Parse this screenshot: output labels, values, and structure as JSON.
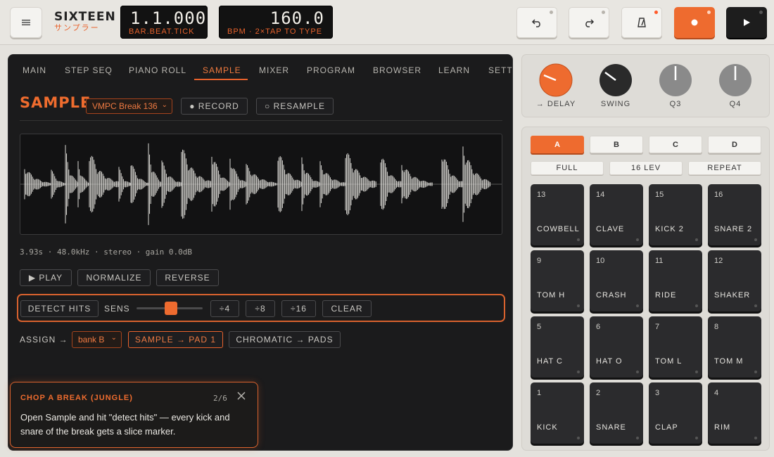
{
  "header": {
    "brand_name": "SIXTEEN",
    "brand_sub": "サンプラー",
    "position_value": "1.1.000",
    "position_label": "BAR.BEAT.TICK",
    "bpm_value": "160.0",
    "bpm_label": "BPM · 2×TAP TO TYPE",
    "buttons": [
      "menu-icon",
      "undo-icon",
      "redo-icon",
      "metronome-icon",
      "record-icon",
      "play-icon"
    ]
  },
  "tabs": [
    "MAIN",
    "STEP SEQ",
    "PIANO ROLL",
    "SAMPLE",
    "MIXER",
    "PROGRAM",
    "BROWSER",
    "LEARN",
    "SETTI"
  ],
  "active_tab": "SAMPLE",
  "sample": {
    "title": "SAMPLE",
    "selected_sample": "VMPC Break 136",
    "record_label": "● RECORD",
    "resample_label": "○ RESAMPLE",
    "info": "3.93s · 48.0kHz · stereo · gain 0.0dB",
    "play_label": "▶ PLAY",
    "normalize_label": "NORMALIZE",
    "reverse_label": "REVERSE",
    "detect_label": "DETECT HITS",
    "sens_label": "SENS",
    "sens_level": 0.5,
    "split4_label": "÷4",
    "split8_label": "÷8",
    "split16_label": "÷16",
    "clear_label": "CLEAR",
    "assign_label": "ASSIGN →",
    "assign_bank": "bank B",
    "sample_to_pad_label": "SAMPLE → PAD 1",
    "chromatic_label": "CHROMATIC → PADS"
  },
  "tour": {
    "title": "CHOP A BREAK (JUNGLE)",
    "step": "2/6",
    "body": "Open Sample and hit \"detect hits\" — every kick and snare of the break gets a slice marker."
  },
  "knobs": [
    {
      "label": "→ DELAY",
      "color": "#ee6b2f"
    },
    {
      "label": "SWING",
      "color": "#2a2a2a"
    },
    {
      "label": "Q3",
      "color": "#8a8a8a"
    },
    {
      "label": "Q4",
      "color": "#8a8a8a"
    }
  ],
  "banks": [
    "A",
    "B",
    "C",
    "D"
  ],
  "active_bank": "A",
  "modes": [
    "FULL",
    "16 LEV",
    "REPEAT"
  ],
  "pads": [
    {
      "num": "13",
      "name": "COWBELL"
    },
    {
      "num": "14",
      "name": "CLAVE"
    },
    {
      "num": "15",
      "name": "KICK 2"
    },
    {
      "num": "16",
      "name": "SNARE 2"
    },
    {
      "num": "9",
      "name": "TOM H"
    },
    {
      "num": "10",
      "name": "CRASH"
    },
    {
      "num": "11",
      "name": "RIDE"
    },
    {
      "num": "12",
      "name": "SHAKER"
    },
    {
      "num": "5",
      "name": "HAT C"
    },
    {
      "num": "6",
      "name": "HAT O"
    },
    {
      "num": "7",
      "name": "TOM L"
    },
    {
      "num": "8",
      "name": "TOM M"
    },
    {
      "num": "1",
      "name": "KICK"
    },
    {
      "num": "2",
      "name": "SNARE"
    },
    {
      "num": "3",
      "name": "CLAP"
    },
    {
      "num": "4",
      "name": "RIM"
    }
  ],
  "colors": {
    "accent": "#ee6b2f",
    "panel_dark": "#1b1b1c",
    "background": "#e4e2dd"
  }
}
